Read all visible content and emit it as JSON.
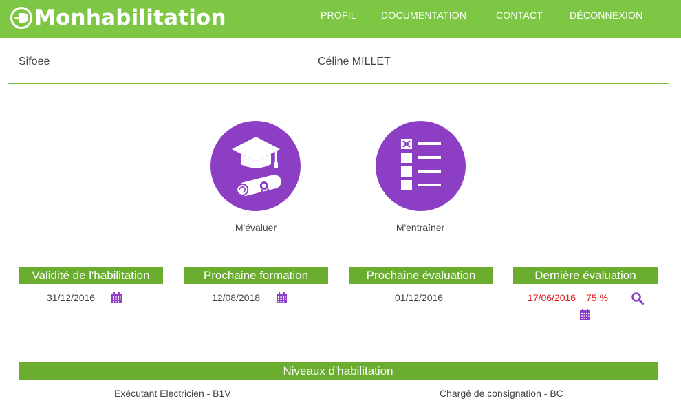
{
  "brand": {
    "name": "Monhabilitation"
  },
  "nav": [
    {
      "label": "PROFIL"
    },
    {
      "label": "DOCUMENTATION"
    },
    {
      "label": "CONTACT"
    },
    {
      "label": "DÉCONNEXION"
    }
  ],
  "org": {
    "name": "Sifoee"
  },
  "user": {
    "name": "Céline MILLET"
  },
  "actions": {
    "evaluate": {
      "label": "M'évaluer",
      "icon": "graduation-diploma-icon"
    },
    "train": {
      "label": "M'entraîner",
      "icon": "checklist-icon"
    }
  },
  "info": {
    "validity": {
      "title": "Validité de l'habilitation",
      "date": "31/12/2016"
    },
    "next_training": {
      "title": "Prochaine formation",
      "date": "12/08/2018"
    },
    "next_evaluation": {
      "title": "Prochaine évaluation",
      "date": "01/12/2016"
    },
    "last_evaluation": {
      "title": "Dernière évaluation",
      "date": "17/06/2016",
      "score": "75 %"
    }
  },
  "levels": {
    "title": "Niveaux d'habilitation",
    "items": [
      {
        "label": "Exécutant Electricien - B1V"
      },
      {
        "label": "Chargé de consignation - BC"
      }
    ]
  },
  "colors": {
    "brand_green": "#7dc744",
    "header_green": "#6aad2f",
    "accent_purple": "#8c3fc4",
    "alert_red": "#e01b1b"
  }
}
